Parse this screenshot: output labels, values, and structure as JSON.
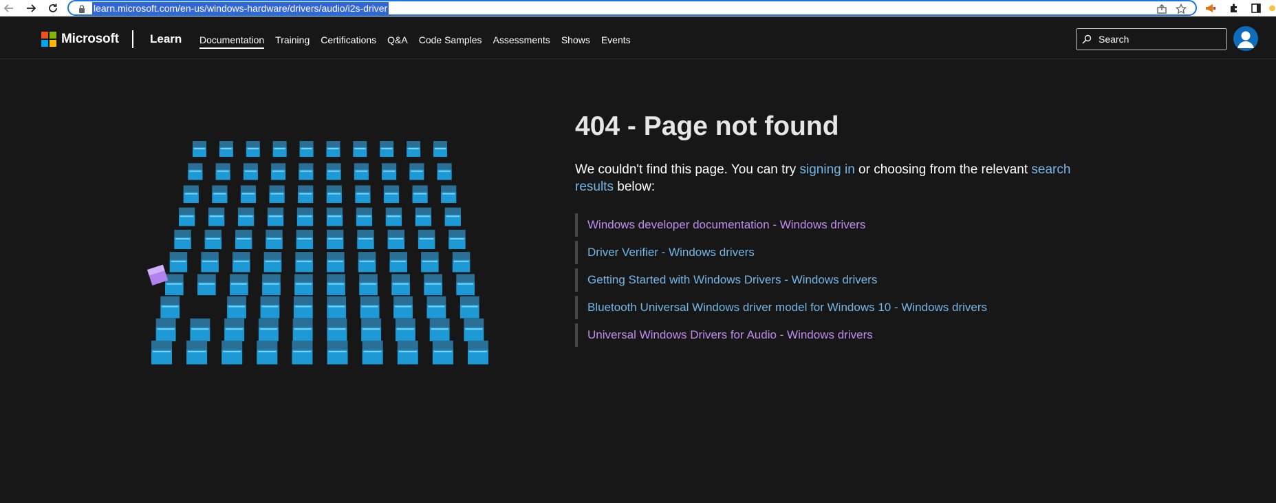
{
  "browser": {
    "url": "learn.microsoft.com/en-us/windows-hardware/drivers/audio/i2s-driver"
  },
  "header": {
    "brand": "Microsoft",
    "product": "Learn",
    "nav": [
      {
        "label": "Documentation",
        "active": true
      },
      {
        "label": "Training"
      },
      {
        "label": "Certifications"
      },
      {
        "label": "Q&A"
      },
      {
        "label": "Code Samples"
      },
      {
        "label": "Assessments"
      },
      {
        "label": "Shows"
      },
      {
        "label": "Events"
      }
    ],
    "search_placeholder": "Search"
  },
  "main": {
    "title": "404 - Page not found",
    "message_before": "We couldn't find this page. You can try ",
    "signin_link": "signing in",
    "message_middle": " or choosing from the relevant ",
    "search_link": "search results",
    "message_after": " below:",
    "results": [
      {
        "label": "Windows developer documentation - Windows drivers",
        "visited": true
      },
      {
        "label": "Driver Verifier - Windows drivers",
        "visited": false
      },
      {
        "label": "Getting Started with Windows Drivers - Windows drivers",
        "visited": false
      },
      {
        "label": "Bluetooth Universal Windows driver model for Windows 10 - Windows drivers",
        "visited": false
      },
      {
        "label": "Universal Windows Drivers for Audio - Windows drivers",
        "visited": true
      }
    ]
  },
  "colors": {
    "background": "#171717",
    "link": "#75b6e7",
    "visited_link": "#c38bf0",
    "cube": "#1d9ad6",
    "odd_cube": "#b283ef",
    "ms_red": "#f25022",
    "ms_green": "#7fba00",
    "ms_blue": "#00a4ef",
    "ms_yellow": "#ffb900"
  }
}
